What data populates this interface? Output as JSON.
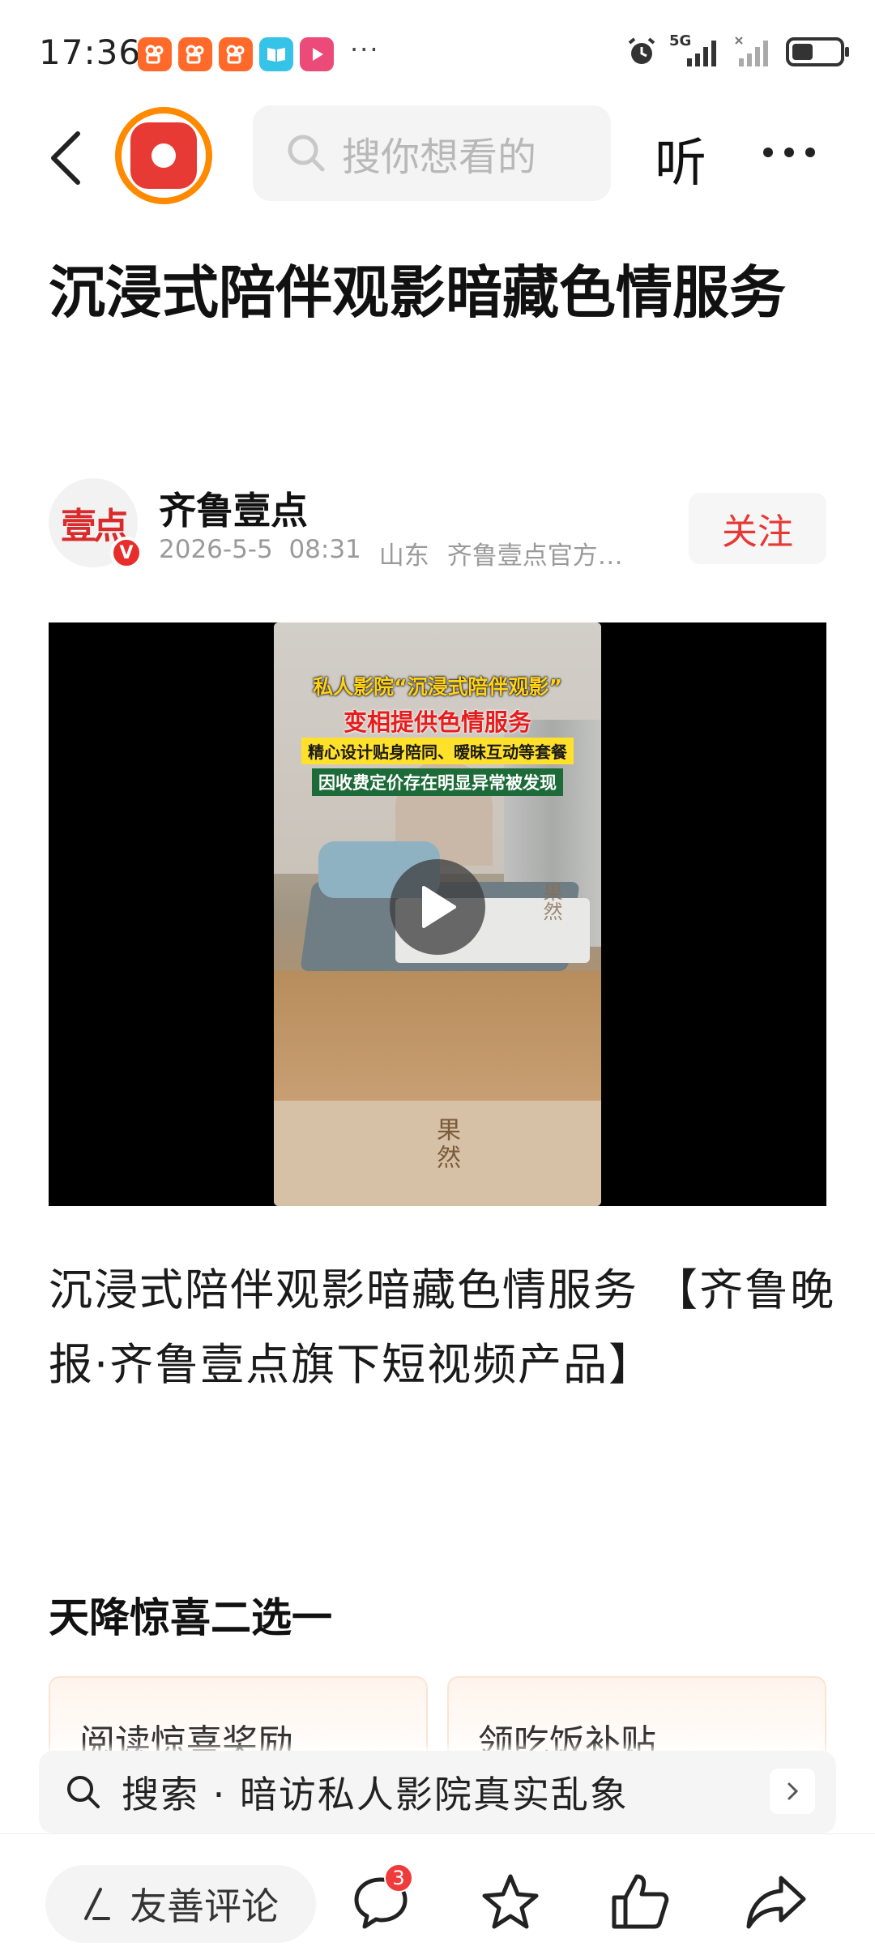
{
  "status_bar": {
    "time": "17:36",
    "notification_icons": [
      "kuaishou-icon",
      "kuaishou-icon",
      "kuaishou-icon",
      "book-reader-icon",
      "video-play-icon"
    ],
    "network": "5G",
    "battery_level": 0.45
  },
  "header": {
    "search_placeholder": "搜你想看的",
    "listen_label": "听"
  },
  "article": {
    "title": "沉浸式陪伴观影暗藏色情服务",
    "author": {
      "name": "齐鲁壹点",
      "avatar_text": "壹点",
      "verified_badge": "V",
      "date": "2026-5-5",
      "time": "08:31",
      "location": "山东",
      "source": "齐鲁壹点官方…"
    },
    "follow_label": "关注",
    "video": {
      "caption_1": "私人影院“沉浸式陪伴观影”",
      "caption_2": "变相提供色情服务",
      "caption_3": "精心设计贴身陪同、暧昧互动等套餐",
      "caption_4": "因收费定价存在明显异常被发现",
      "watermark": "果然"
    },
    "description": "沉浸式陪伴观影暗藏色情服务 【齐鲁晚报·齐鲁壹点旗下短视频产品】"
  },
  "surprise": {
    "title": "天降惊喜二选一",
    "cards": [
      "阅读惊喜奖励",
      "领吃饭补贴"
    ]
  },
  "search_suggestion": {
    "text": "搜索 · 暗访私人影院真实乱象"
  },
  "bottom_bar": {
    "comment_placeholder": "友善评论",
    "comment_count": "3"
  },
  "colors": {
    "accent_red": "#e53935",
    "logo_orange": "#ff8a00"
  }
}
